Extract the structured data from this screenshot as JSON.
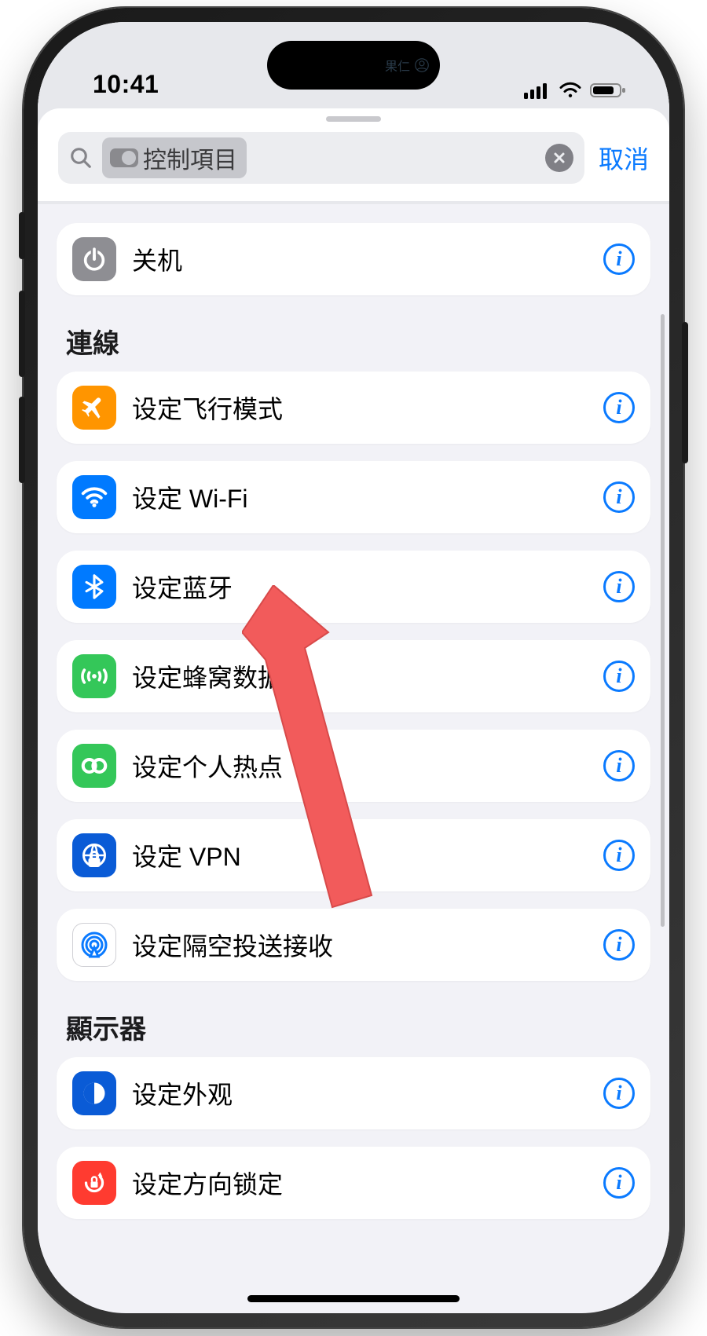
{
  "status": {
    "time": "10:41",
    "island_text": "果仁"
  },
  "search": {
    "token_text": "控制項目",
    "cancel": "取消"
  },
  "sections": [
    {
      "title_key": null,
      "items": [
        {
          "label": "关机",
          "icon": "power-icon",
          "bg": "ic-power"
        }
      ]
    },
    {
      "title": "連線",
      "items": [
        {
          "label": "设定飞行模式",
          "icon": "airplane-icon",
          "bg": "ic-airplane"
        },
        {
          "label": "设定 Wi-Fi",
          "icon": "wifi-icon",
          "bg": "ic-wifi"
        },
        {
          "label": "设定蓝牙",
          "icon": "bluetooth-icon",
          "bg": "ic-bt"
        },
        {
          "label": "设定蜂窝数据",
          "icon": "cellular-icon",
          "bg": "ic-cell"
        },
        {
          "label": "设定个人热点",
          "icon": "hotspot-icon",
          "bg": "ic-hotspot"
        },
        {
          "label": "设定 VPN",
          "icon": "vpn-icon",
          "bg": "ic-vpn"
        },
        {
          "label": "设定隔空投送接收",
          "icon": "airdrop-icon",
          "bg": "ic-airdrop"
        }
      ]
    },
    {
      "title": "顯示器",
      "items": [
        {
          "label": "设定外观",
          "icon": "appearance-icon",
          "bg": "ic-appearance"
        },
        {
          "label": "设定方向锁定",
          "icon": "rotation-lock-icon",
          "bg": "ic-lock"
        }
      ]
    }
  ]
}
